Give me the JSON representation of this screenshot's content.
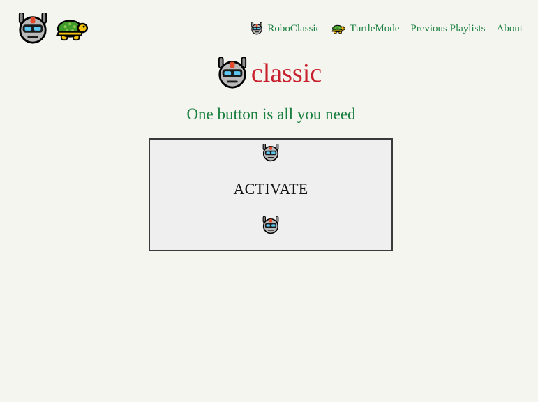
{
  "logo": {
    "icons": [
      "robot-icon",
      "turtle-icon"
    ]
  },
  "nav": {
    "items": [
      {
        "label": "RoboClassic",
        "icon": "robot-icon"
      },
      {
        "label": "TurtleMode",
        "icon": "turtle-icon"
      },
      {
        "label": "Previous Playlists"
      },
      {
        "label": "About"
      }
    ]
  },
  "main": {
    "title": "classic",
    "title_icon": "robot-icon",
    "tagline": "One button is all you need",
    "button": {
      "label": "ACTIVATE",
      "icon": "robot-icon"
    }
  },
  "colors": {
    "background": "#f5f5f0",
    "title": "#c8202c",
    "accent_green": "#1a8040",
    "button_bg": "#efefef",
    "button_border": "#3a3a3a"
  }
}
